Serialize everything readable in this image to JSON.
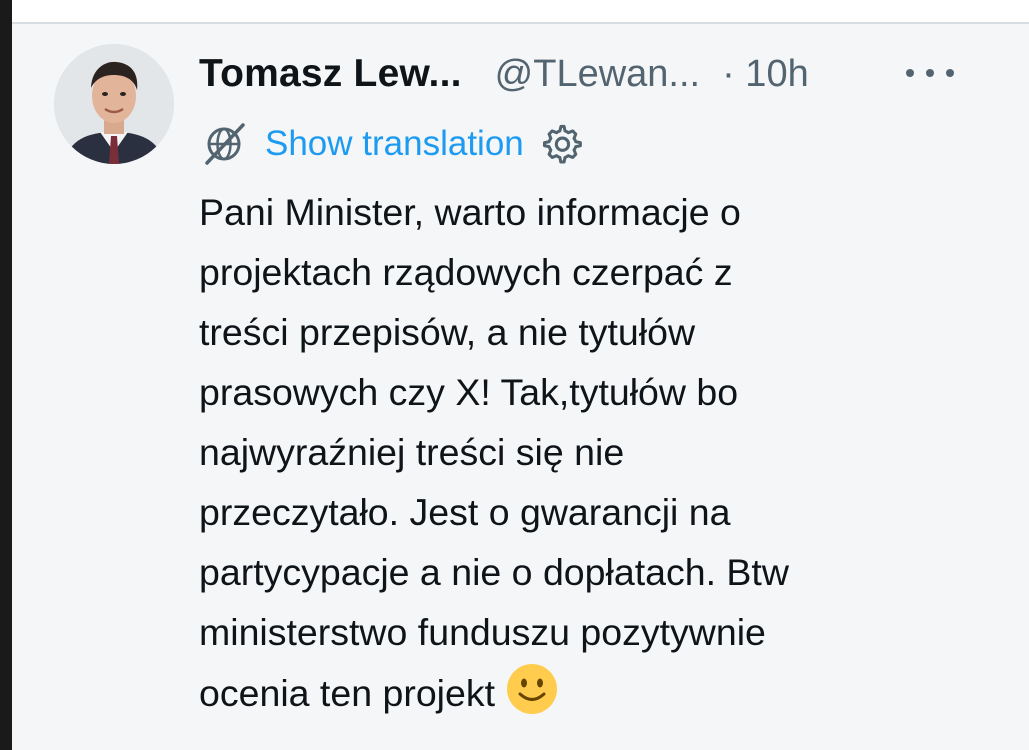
{
  "tweet": {
    "author_name": "Tomasz Lew...",
    "author_handle": "@TLewan...",
    "timestamp": "· 10h",
    "more_icon": "more-horizontal-icon",
    "translate_icon": "translate-globe-icon",
    "show_translation": "Show translation",
    "settings_icon": "gear-icon",
    "body_lines": [
      "Pani Minister, warto informacje o",
      "projektach rządowych czerpać z",
      "treści przepisów, a nie tytułów",
      "prasowych czy X! Tak,tytułów bo",
      "najwyraźniej treści się nie",
      "przeczytało. Jest o gwarancji na",
      "partycypacje a nie o dopłatach. Btw",
      "ministerstwo funduszu pozytywnie",
      "ocenia ten projekt"
    ],
    "emoji": "slightly-smiling-face-icon",
    "link_color": "#1d9bf0",
    "text_color": "#0f1419",
    "muted_color": "#536471"
  }
}
